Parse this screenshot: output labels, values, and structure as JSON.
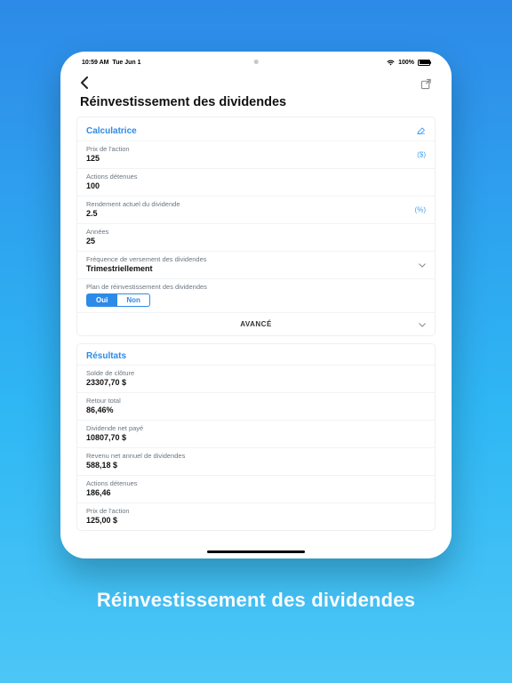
{
  "status": {
    "time": "10:59 AM",
    "date": "Tue Jun 1",
    "battery_pct": "100%"
  },
  "header": {
    "title": "Réinvestissement des dividendes"
  },
  "calc": {
    "card_title": "Calculatrice",
    "fields": {
      "price": {
        "label": "Prix de l'action",
        "value": "125",
        "suffix": "($)"
      },
      "shares": {
        "label": "Actions détenues",
        "value": "100"
      },
      "yield": {
        "label": "Rendement actuel du dividende",
        "value": "2.5",
        "suffix": "(%)"
      },
      "years": {
        "label": "Années",
        "value": "25"
      },
      "freq": {
        "label": "Fréquence de versement des dividendes",
        "value": "Trimestriellement"
      },
      "drip": {
        "label": "Plan de réinvestissement des dividendes",
        "yes": "Oui",
        "no": "Non"
      }
    },
    "advanced": "AVANCÉ"
  },
  "results": {
    "card_title": "Résultats",
    "items": {
      "closing": {
        "label": "Solde de clôture",
        "value": "23307,70 $"
      },
      "total_return": {
        "label": "Retour total",
        "value": "86,46%"
      },
      "net_paid": {
        "label": "Dividende net payé",
        "value": "10807,70 $"
      },
      "annual_income": {
        "label": "Revenu net annuel de dividendes",
        "value": "588,18 $"
      },
      "shares_held": {
        "label": "Actions détenues",
        "value": "186,46"
      },
      "price": {
        "label": "Prix de l'action",
        "value": "125,00 $"
      }
    }
  },
  "caption": "Réinvestissement des dividendes"
}
